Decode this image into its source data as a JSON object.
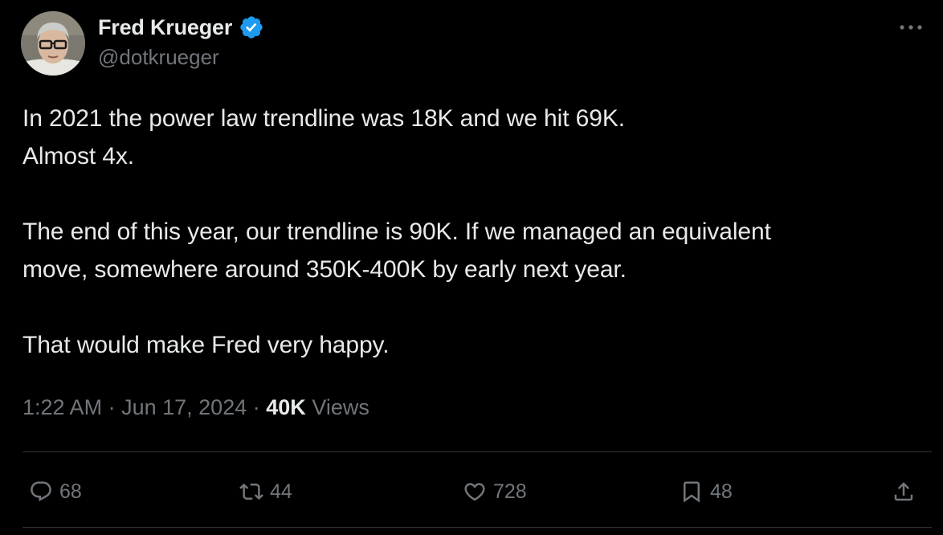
{
  "author": {
    "display_name": "Fred Krueger",
    "handle": "@dotkrueger",
    "verified_icon": "verified-badge-icon",
    "verified_color": "#1d9bf0"
  },
  "tweet": {
    "paragraphs": [
      [
        "In 2021 the power law trendline was 18K and we hit 69K.",
        "Almost 4x."
      ],
      [
        "The end of this year, our trendline is 90K. If we managed an equivalent",
        "move, somewhere around 350K-400K by early next year."
      ],
      [
        "That would make Fred very happy."
      ]
    ]
  },
  "meta": {
    "time": "1:22 AM",
    "separator": "·",
    "date": "Jun 17, 2024",
    "views_count": "40K",
    "views_label": "Views"
  },
  "actions": {
    "replies": {
      "count": "68",
      "icon": "reply-icon"
    },
    "reposts": {
      "count": "44",
      "icon": "repost-icon"
    },
    "likes": {
      "count": "728",
      "icon": "like-icon"
    },
    "bookmarks": {
      "count": "48",
      "icon": "bookmark-icon"
    },
    "share": {
      "icon": "share-icon"
    }
  },
  "more_icon": "more-options-icon",
  "colors": {
    "background": "#000000",
    "text_primary": "#e7e9ea",
    "text_secondary": "#71767b",
    "divider": "#2f3336",
    "accent": "#1d9bf0"
  }
}
